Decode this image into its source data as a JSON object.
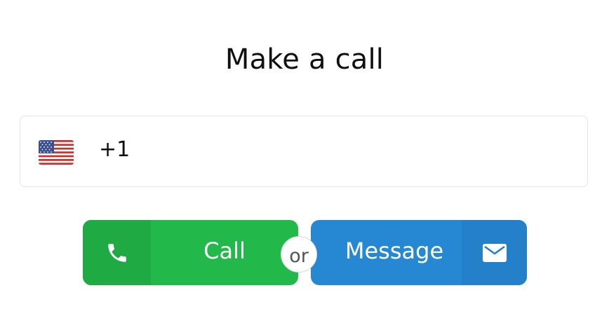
{
  "title": "Make a call",
  "phone": {
    "country_flag": "us-flag-icon",
    "value": "+1"
  },
  "actions": {
    "call_label": "Call",
    "call_icon": "phone-icon",
    "separator_label": "or",
    "message_label": "Message",
    "message_icon": "envelope-icon"
  },
  "colors": {
    "call_button": "#22b84a",
    "message_button": "#2687d2",
    "title_text": "#111111"
  }
}
